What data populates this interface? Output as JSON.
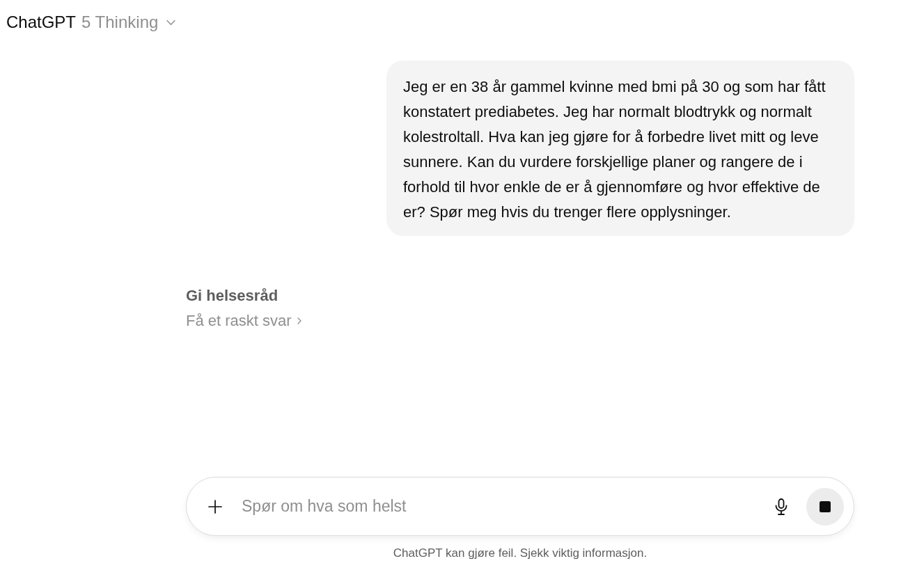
{
  "header": {
    "title": "ChatGPT",
    "model": "5 Thinking"
  },
  "messages": [
    {
      "kind": "user",
      "text": "Jeg er en 38 år gammel kvinne med bmi på 30 og som har fått konstatert prediabetes. Jeg har normalt blodtrykk og normalt kolestroltall. Hva kan jeg gjøre for å forbedre livet mitt og leve sunnere. Kan du vurdere forskjellige planer og rangere de i forhold til hvor enkle de er å gjennomføre og hvor effektive de er? Spør meg hvis du trenger flere opplysninger."
    }
  ],
  "thinking": {
    "title": "Gi helsesråd",
    "action": "Få et raskt svar"
  },
  "composer": {
    "placeholder": "Spør om hva som helst",
    "generating": true
  },
  "disclaimer": "ChatGPT kan gjøre feil. Sjekk viktig informasjon."
}
